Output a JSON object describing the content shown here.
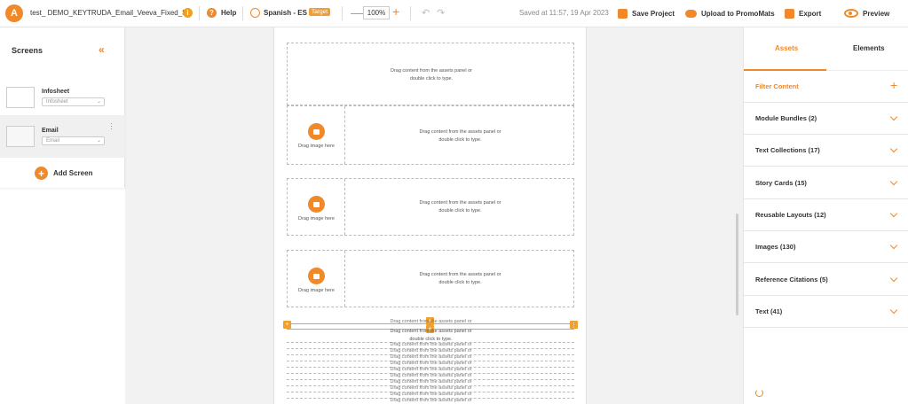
{
  "app": {
    "logo": "A",
    "project_title": "test_ DEMO_KEYTRUDA_Email_Veeva_Fixed_S...",
    "help_label": "Help",
    "language": "Spanish - ES",
    "target_badge": "Target",
    "zoom": "100%",
    "saved_status": "Saved at 11:57, 19 Apr 2023",
    "save_label": "Save Project",
    "upload_label": "Upload to PromoMats",
    "export_label": "Export",
    "preview_label": "Preview",
    "accent_color": "#f0892a"
  },
  "left_panel": {
    "title": "Screens",
    "screens": [
      {
        "name": "Infosheet",
        "select_value": "Infosheet"
      },
      {
        "name": "Email",
        "select_value": "Email"
      }
    ],
    "add_screen_label": "Add Screen"
  },
  "canvas": {
    "drag_text_line1": "Drag content from the assets panel or",
    "drag_text_line2": "double click to type.",
    "drag_image_label": "Drag image here"
  },
  "right_panel": {
    "tabs": [
      "Assets",
      "Elements"
    ],
    "filter_label": "Filter Content",
    "categories": [
      "Module Bundles (2)",
      "Text Collections (17)",
      "Story Cards (15)",
      "Reusable Layouts (12)",
      "Images (130)",
      "Reference Citations (5)",
      "Text (41)"
    ]
  }
}
